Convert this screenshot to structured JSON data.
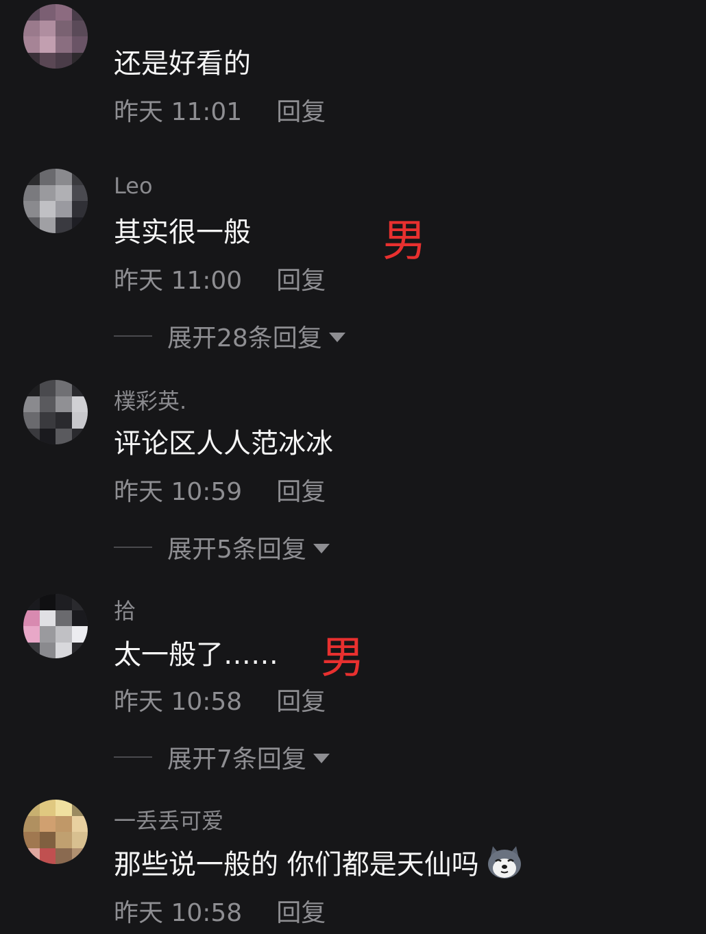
{
  "comments": [
    {
      "username": "",
      "text": "还是好看的",
      "time": "昨天 11:01",
      "reply": "回复"
    },
    {
      "username": "Leo",
      "text": "其实很一般",
      "time": "昨天 11:00",
      "reply": "回复",
      "expand": "展开28条回复",
      "annotation": "男"
    },
    {
      "username": "樸彩英.",
      "text": "评论区人人范冰冰",
      "time": "昨天 10:59",
      "reply": "回复",
      "expand": "展开5条回复"
    },
    {
      "username": "拾",
      "text": "太一般了……",
      "time": "昨天 10:58",
      "reply": "回复",
      "expand": "展开7条回复",
      "annotation": "男"
    },
    {
      "username": "一丢丢可爱",
      "text": "那些说一般的 你们都是天仙吗",
      "time": "昨天 10:58",
      "reply": "回复",
      "emoji": "husky-emoji"
    }
  ],
  "colors": {
    "background": "#161618",
    "text_primary": "#f5f5f5",
    "text_secondary": "#8e8e92",
    "annotation": "#e8302f"
  }
}
